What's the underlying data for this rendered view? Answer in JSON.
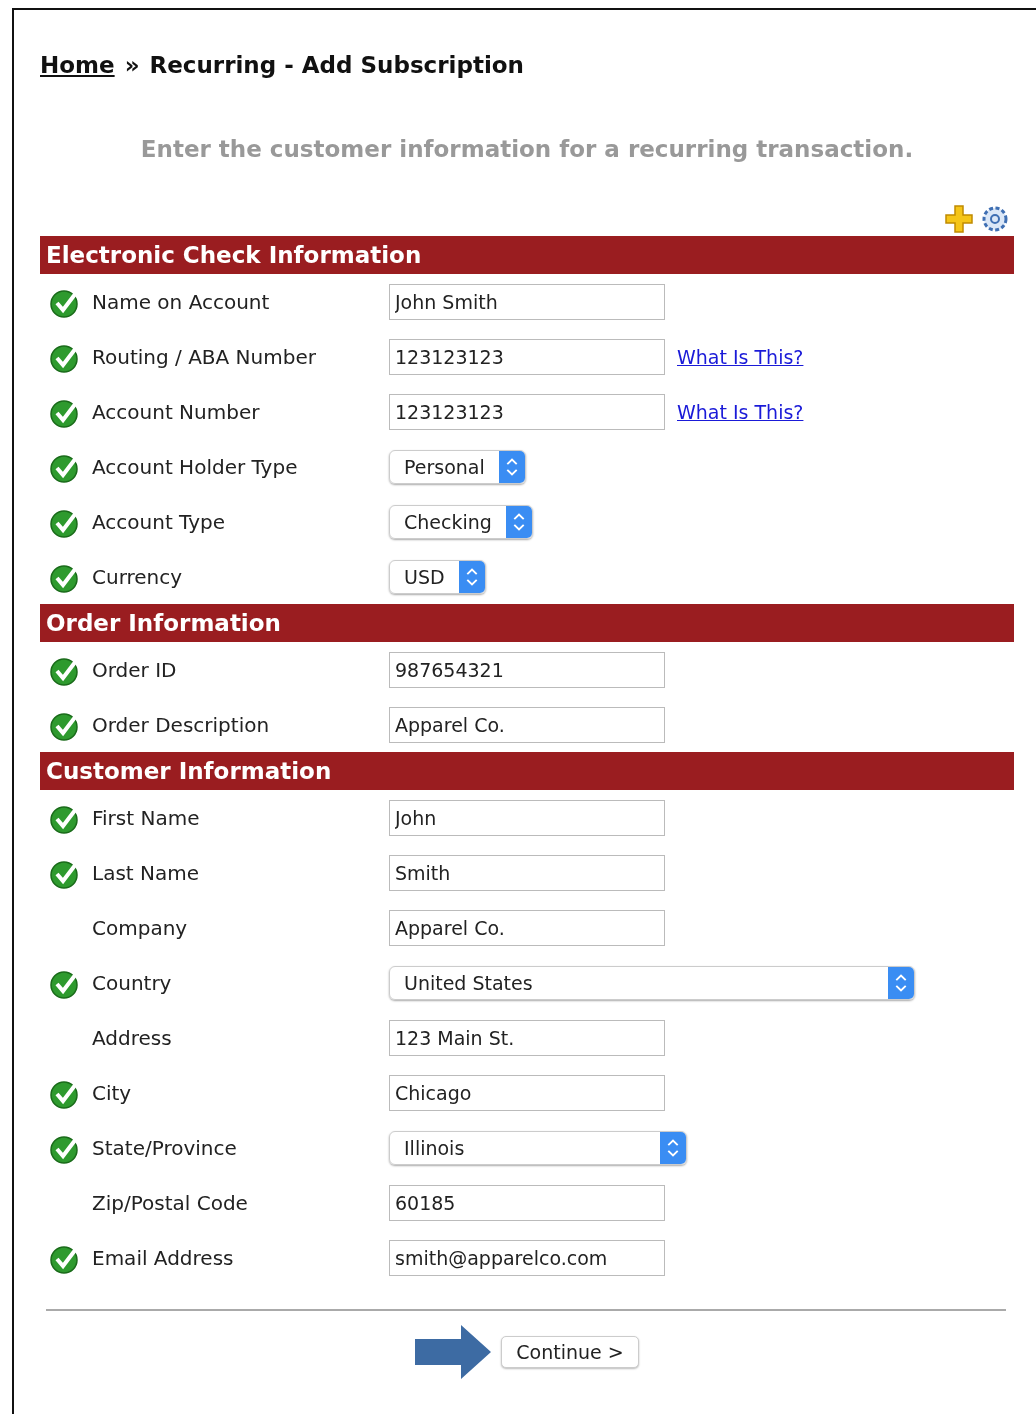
{
  "breadcrumb": {
    "home": "Home",
    "separator": "»",
    "current": "Recurring - Add Subscription"
  },
  "intro": "Enter the customer information for a recurring transaction.",
  "sections": [
    {
      "title": "Electronic Check Information",
      "fields": [
        {
          "label": "Name on Account",
          "kind": "text",
          "value": "John Smith",
          "validated": true
        },
        {
          "label": "Routing / ABA Number",
          "kind": "text",
          "value": "123123123",
          "validated": true,
          "link": "What Is This?"
        },
        {
          "label": "Account Number",
          "kind": "text",
          "value": "123123123",
          "validated": true,
          "link": "What Is This?"
        },
        {
          "label": "Account Holder Type",
          "kind": "select",
          "value": "Personal",
          "validated": true
        },
        {
          "label": "Account Type",
          "kind": "select",
          "value": "Checking",
          "validated": true
        },
        {
          "label": "Currency",
          "kind": "select",
          "value": "USD",
          "validated": true
        }
      ]
    },
    {
      "title": "Order Information",
      "fields": [
        {
          "label": "Order ID",
          "kind": "text",
          "value": "987654321",
          "validated": true
        },
        {
          "label": "Order Description",
          "kind": "text",
          "value": "Apparel Co.",
          "validated": true
        }
      ]
    },
    {
      "title": "Customer Information",
      "fields": [
        {
          "label": "First Name",
          "kind": "text",
          "value": "John",
          "validated": true
        },
        {
          "label": "Last Name",
          "kind": "text",
          "value": "Smith",
          "validated": true
        },
        {
          "label": "Company",
          "kind": "text",
          "value": "Apparel Co.",
          "validated": false
        },
        {
          "label": "Country",
          "kind": "select",
          "value": "United States",
          "validated": true
        },
        {
          "label": "Address",
          "kind": "text",
          "value": "123 Main St.",
          "validated": false
        },
        {
          "label": "City",
          "kind": "text",
          "value": "Chicago",
          "validated": true
        },
        {
          "label": "State/Province",
          "kind": "select",
          "value": "Illinois",
          "validated": true
        },
        {
          "label": "Zip/Postal Code",
          "kind": "text",
          "value": "60185",
          "validated": false
        },
        {
          "label": "Email Address",
          "kind": "text",
          "value": "smith@apparelco.com",
          "validated": true
        }
      ]
    }
  ],
  "continue_button": "Continue >"
}
